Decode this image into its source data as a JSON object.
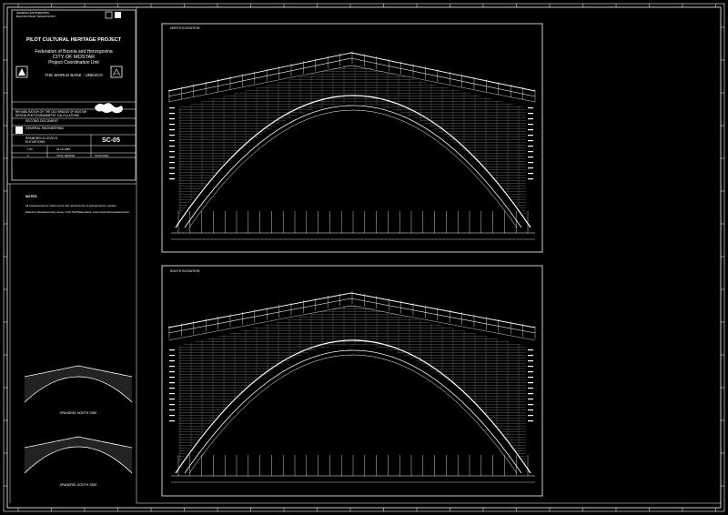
{
  "header": {
    "corner_line1": "GENERAL ENGINEERING",
    "corner_line2": "BALKAN ROAD TECHNOLOGY",
    "project_title": "PILOT CULTURAL HERITAGE PROJECT",
    "federation": "Federation of Bosnia and Herzegovina",
    "city": "CITY OF MOSTAR",
    "unit": "Project Coordination Unit",
    "sponsor": "THE WORLD BANK - UNESCO"
  },
  "title_block": {
    "project_line1": "REHABILITATION OF THE OLD BRIDGE OF MOSTAR",
    "project_line2": "DESIGN PHOTOGRAMMETRY CALCULATIONS",
    "document": "SECOND DOCUMENT",
    "company": "GENERAL ENGINEERING",
    "drawing_title1": "SPANDRELS LEVELS",
    "drawing_title2": "ELEVATIONS",
    "sheet_code": "SC-05",
    "scale": "1:50",
    "date": "31.10.1999",
    "rev": "0",
    "drawn_by": "TOOL DESIGN",
    "file_no": "SC05.DWG"
  },
  "notes": {
    "heading": "NOTES:",
    "line1": "All measurements in meters at the axis reference line of spandrel &amp; parapet",
    "line2": "Data from photogrammetry survey of the Old Bridge &amp; cross check field measurements"
  },
  "views": {
    "north": "NORTH ELEVATION",
    "south": "SOUTH ELEVATION",
    "spandrel_north": "SPANDREL NORTH SIDE",
    "spandrel_south": "SPANDREL SOUTH SIDE"
  }
}
